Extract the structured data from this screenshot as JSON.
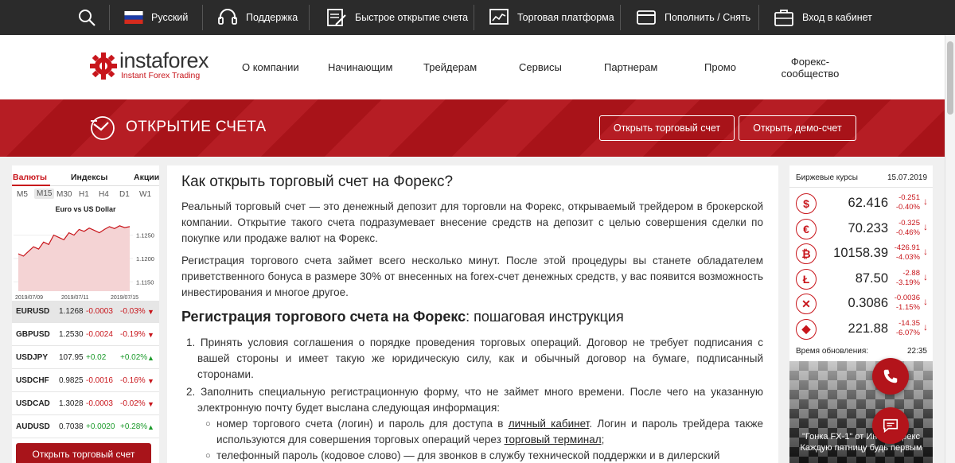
{
  "topbar": {
    "language": "Русский",
    "support": "Поддержка",
    "quick_open": "Быстрое открытие счета",
    "platform": "Торговая платформа",
    "deposit": "Пополнить / Снять",
    "login": "Вход в кабинет"
  },
  "logo": {
    "name": "instaforex",
    "tagline": "Instant Forex Trading"
  },
  "nav": [
    "О компании",
    "Начинающим",
    "Трейдерам",
    "Сервисы",
    "Партнерам",
    "Промо"
  ],
  "nav_two_line": [
    "Форекс-",
    "сообщество"
  ],
  "banner": {
    "title": "ОТКРЫТИЕ СЧЕТА",
    "btn_real": "Открыть торговый счет",
    "btn_demo": "Открыть демо-счет"
  },
  "quotes": {
    "tabs": [
      "Валюты",
      "Индексы",
      "Акции"
    ],
    "timeframes": [
      "M5",
      "M15",
      "M30",
      "H1",
      "H4",
      "D1",
      "W1"
    ],
    "chart_title": "Euro vs US Dollar",
    "y_ticks": [
      "1.1250",
      "1.1200",
      "1.1150"
    ],
    "x_ticks": [
      "2019/07/09",
      "2019/07/11",
      "2019/07/15"
    ],
    "rows": [
      {
        "symbol": "EURUSD",
        "price": "1.1268",
        "change": "-0.0003",
        "percent": "-0.03%",
        "dir": "down"
      },
      {
        "symbol": "GBPUSD",
        "price": "1.2530",
        "change": "-0.0024",
        "percent": "-0.19%",
        "dir": "down"
      },
      {
        "symbol": "USDJPY",
        "price": "107.95",
        "change": "+0.02",
        "percent": "+0.02%",
        "dir": "up"
      },
      {
        "symbol": "USDCHF",
        "price": "0.9825",
        "change": "-0.0016",
        "percent": "-0.16%",
        "dir": "down"
      },
      {
        "symbol": "USDCAD",
        "price": "1.3028",
        "change": "-0.0003",
        "percent": "-0.02%",
        "dir": "down"
      },
      {
        "symbol": "AUDUSD",
        "price": "0.7038",
        "change": "+0.0020",
        "percent": "+0.28%",
        "dir": "up"
      }
    ],
    "button": "Открыть торговый счет"
  },
  "chart_data": {
    "type": "area",
    "title": "Euro vs US Dollar",
    "x": [
      "2019/07/09",
      "2019/07/11",
      "2019/07/15"
    ],
    "ylim": [
      1.113,
      1.129
    ],
    "y_ticks": [
      1.125,
      1.12,
      1.115
    ],
    "values": [
      1.121,
      1.1205,
      1.1215,
      1.1225,
      1.122,
      1.1235,
      1.123,
      1.125,
      1.1245,
      1.124,
      1.1255,
      1.125,
      1.1262,
      1.1258,
      1.1265,
      1.126,
      1.1255,
      1.1262,
      1.1268,
      1.1264,
      1.127,
      1.1266,
      1.1268
    ]
  },
  "main": {
    "title": "Как открыть торговый счет на Форекс?",
    "p1": "Реальный торговый счет — это денежный депозит для торговли на Форекс, открываемый трейдером в брокерской компании. Открытие такого счета подразумевает внесение средств на депозит с целью совершения сделки по покупке или продаже валют на Форекс.",
    "p2": "Регистрация торгового счета займет всего несколько минут. После этой процедуры вы станете обладателем приветственного бонуса в размере 30% от внесенных на forex-счет денежных средств, у вас появится возможность инвестирования и многое другое.",
    "h2_bold": "Регистрация торгового счета на Форекс",
    "h2_rest": ": пошаговая инструкция",
    "step1": "1. Принять условия соглашения о порядке проведения торговых операций. Договор не требует подписания с вашей стороны и имеет такую же юридическую силу, как и обычный договор на бумаге, подписанный сторонами.",
    "step2": "2. Заполнить специальную регистрационную форму, что не займет много времени. После чего на указанную электронную почту будет выслана следующая информация:",
    "bullet1_a": "номер торгового счета (логин) и пароль для доступа в ",
    "bullet1_link1": "личный кабинет",
    "bullet1_b": ". Логин и пароль трейдера также используются для совершения торговых операций через ",
    "bullet1_link2": "торговый терминал",
    "bullet1_c": ";",
    "bullet2": "телефонный пароль (кодовое слово) — для звонков в службу технической поддержки и в дилерский"
  },
  "rates": {
    "header": "Биржевые курсы",
    "date": "15.07.2019",
    "rows": [
      {
        "icon": "dollar-icon",
        "glyph": "$",
        "value": "62.416",
        "d1": "-0.251",
        "d2": "-0.40%"
      },
      {
        "icon": "euro-icon",
        "glyph": "€",
        "value": "70.233",
        "d1": "-0.325",
        "d2": "-0.46%"
      },
      {
        "icon": "bitcoin-icon",
        "glyph": "₿",
        "value": "10158.39",
        "d1": "-426.91",
        "d2": "-4.03%"
      },
      {
        "icon": "litecoin-icon",
        "glyph": "Ł",
        "value": "87.50",
        "d1": "-2.88",
        "d2": "-3.19%"
      },
      {
        "icon": "ripple-icon",
        "glyph": "✕",
        "value": "0.3086",
        "d1": "-0.0036",
        "d2": "-1.15%"
      },
      {
        "icon": "ethereum-icon",
        "glyph": "◆",
        "value": "221.88",
        "d1": "-14.35",
        "d2": "-6.07%"
      }
    ],
    "update_label": "Время обновления:",
    "update_time": "22:35"
  },
  "promo": {
    "line1": "\"Гонка FX-1\" от ИнстаФорекс",
    "line2": "Каждую пятницу будь первым"
  },
  "colors": {
    "brand_red": "#b3141b",
    "negative": "#c8151b",
    "positive": "#1b9a2a"
  }
}
